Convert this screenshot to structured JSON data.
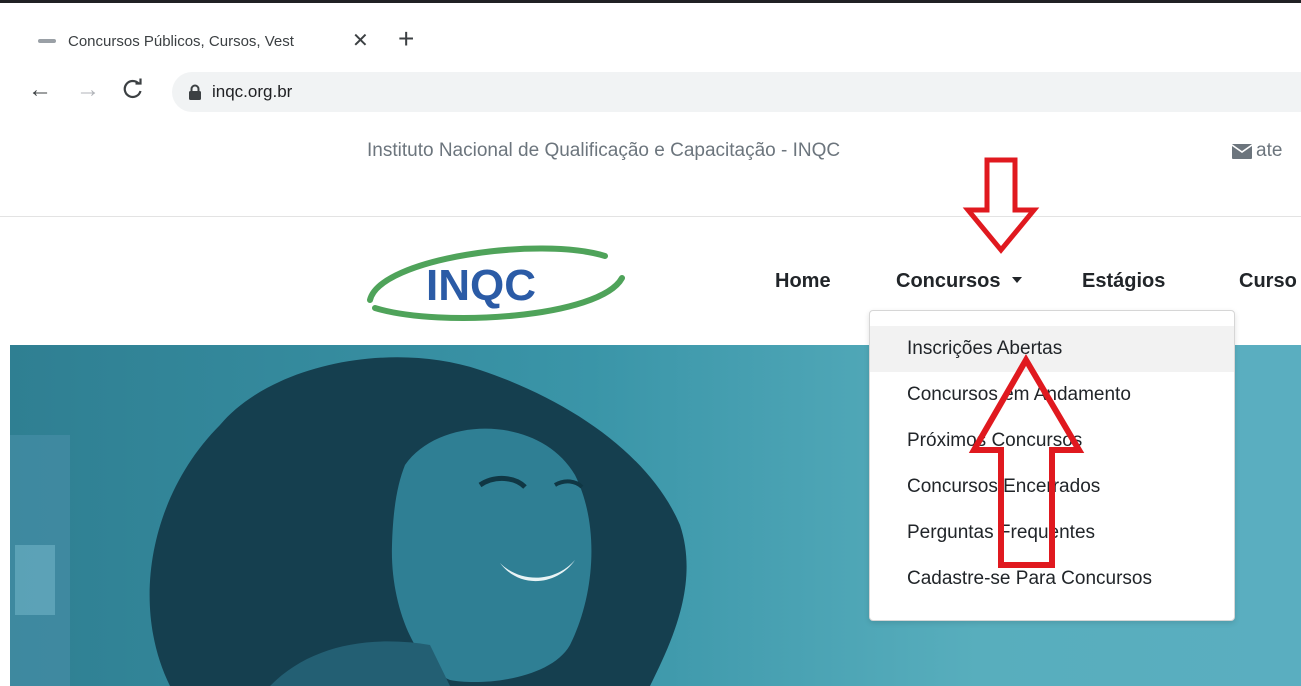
{
  "browser": {
    "tab_title": "Concursos Públicos, Cursos, Vest",
    "url": "inqc.org.br",
    "close_glyph": "✕",
    "new_tab_glyph": "+",
    "back_glyph": "←",
    "forward_glyph": "→",
    "reload_glyph": "C"
  },
  "header": {
    "title": "Instituto Nacional de Qualificação e Capacitação - INQC",
    "email_partial": "ate"
  },
  "logo": {
    "text": "INQC",
    "text_color": "#2b5ba6",
    "swoosh_color": "#4fa35a"
  },
  "nav": {
    "items": [
      {
        "label": "Home"
      },
      {
        "label": "Concursos"
      },
      {
        "label": "Estágios"
      },
      {
        "label": "Curso"
      }
    ]
  },
  "dropdown": {
    "items": [
      {
        "label": "Inscrições Abertas",
        "highlighted": true
      },
      {
        "label": "Concursos em Andamento"
      },
      {
        "label": "Próximos Concursos"
      },
      {
        "label": "Concursos Encerrados"
      },
      {
        "label": "Perguntas Frequentes"
      },
      {
        "label": "Cadastre-se Para Concursos"
      }
    ]
  },
  "annotations": {
    "arrow_color": "#e0191f",
    "icons": [
      "arrow-down-icon",
      "arrow-up-icon"
    ]
  },
  "colors": {
    "hero_teal": "#3a95a8"
  }
}
